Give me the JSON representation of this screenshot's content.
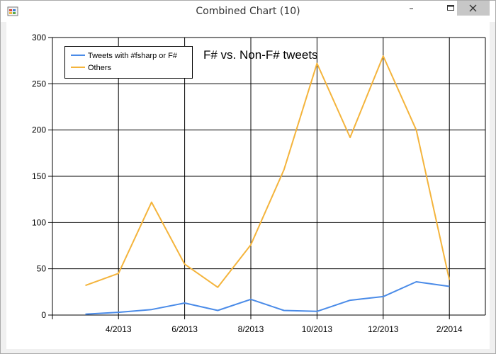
{
  "window": {
    "title": "Combined Chart (10)"
  },
  "icons": {
    "app": "app-icon",
    "minimize": "minimize-icon",
    "maximize": "maximize-icon",
    "close": "close-icon"
  },
  "colors": {
    "fsharp_series": "#4a8be8",
    "others_series": "#f4b43c",
    "grid": "#000000",
    "close_button": "#c7c7c7"
  },
  "chart_data": {
    "type": "line",
    "title": "F# vs. Non-F# tweets",
    "xlabel": "",
    "ylabel": "",
    "x_ticks": [
      "4/2013",
      "6/2013",
      "8/2013",
      "10/2013",
      "12/2013",
      "2/2014"
    ],
    "y_ticks": [
      0,
      50,
      100,
      150,
      200,
      250,
      300
    ],
    "ylim": [
      0,
      300
    ],
    "grid": true,
    "legend_position": "top-left",
    "x": [
      "2013-03",
      "2013-04",
      "2013-05",
      "2013-06",
      "2013-07",
      "2013-08",
      "2013-09",
      "2013-10",
      "2013-11",
      "2013-12",
      "2014-01",
      "2014-02"
    ],
    "series": [
      {
        "name": "Tweets with #fsharp or F#",
        "color": "#4a8be8",
        "values": [
          1,
          3,
          6,
          13,
          5,
          17,
          5,
          4,
          16,
          20,
          36,
          31
        ]
      },
      {
        "name": "Others",
        "color": "#f4b43c",
        "values": [
          32,
          45,
          122,
          55,
          30,
          76,
          157,
          272,
          192,
          280,
          200,
          38
        ]
      }
    ]
  }
}
